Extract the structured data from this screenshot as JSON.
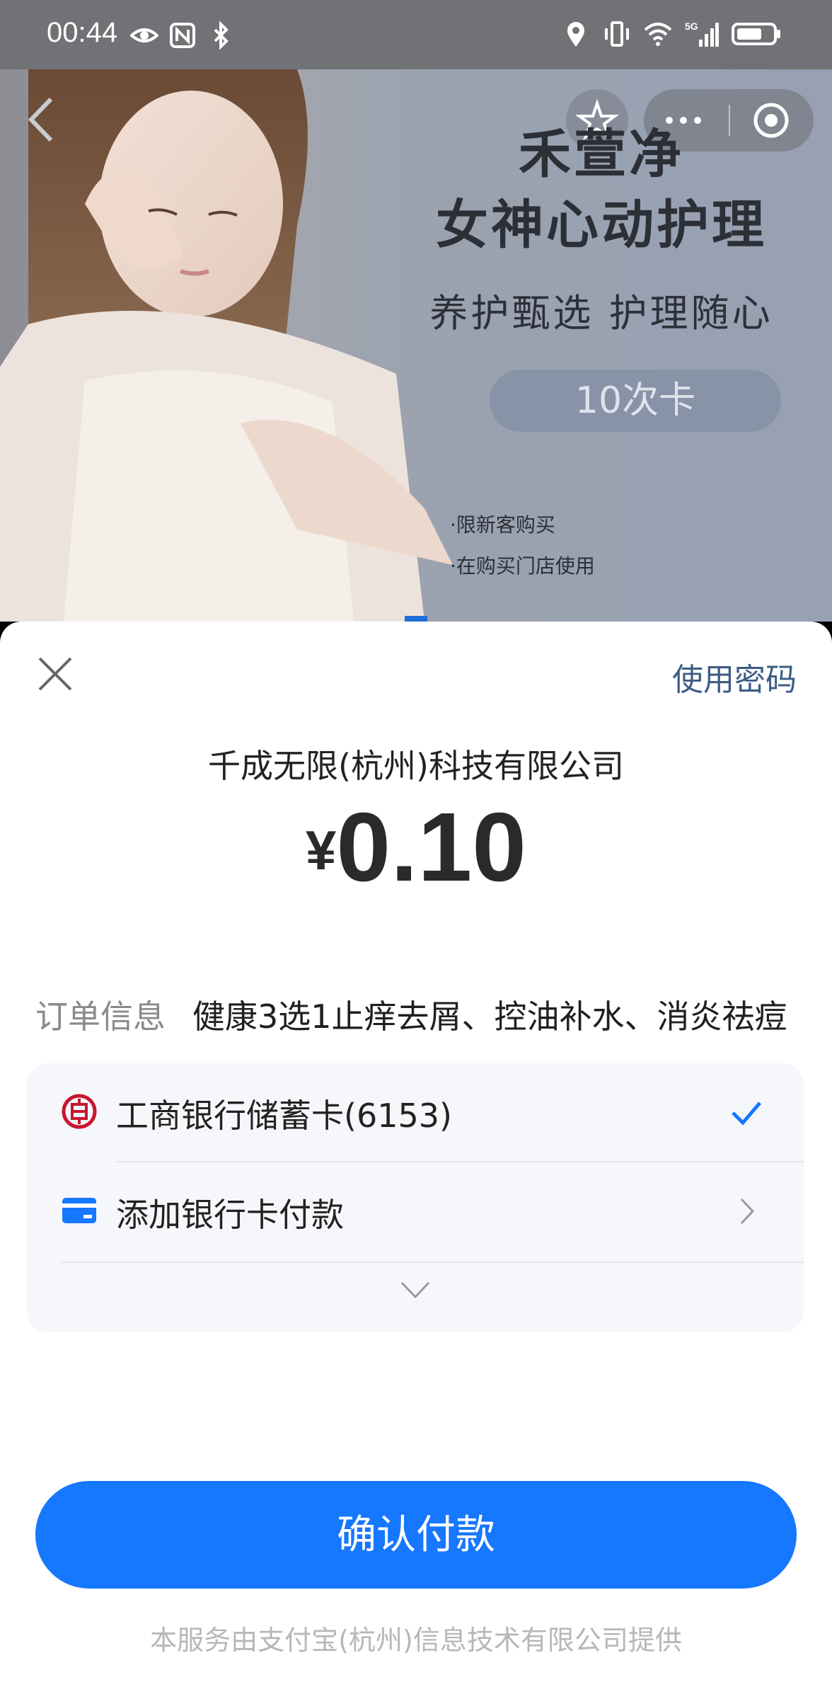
{
  "status_bar": {
    "time": "00:44",
    "network": "5G"
  },
  "banner": {
    "title": "禾萱净",
    "subtitle": "女神心动护理",
    "tagline": "养护甄选  护理随心",
    "badge": "10次卡",
    "notes": [
      "·限新客购买",
      "·在购买门店使用"
    ]
  },
  "sheet": {
    "use_password": "使用密码",
    "merchant": "千成无限(杭州)科技有限公司",
    "currency": "¥",
    "amount": "0.10",
    "order_label": "订单信息",
    "order_value": "健康3选1止痒去屑、控油补水、消炎祛痘",
    "payment_methods": [
      {
        "label": "工商银行储蓄卡(6153)",
        "icon": "icbc-logo-icon",
        "selected": true
      },
      {
        "label": "添加银行卡付款",
        "icon": "bank-card-icon",
        "selected": false
      }
    ],
    "confirm_label": "确认付款",
    "footer": "本服务由支付宝(杭州)信息技术有限公司提供"
  },
  "colors": {
    "primary": "#1677ff",
    "icbc_red": "#c7162e",
    "link_blue": "#3d5c85"
  }
}
